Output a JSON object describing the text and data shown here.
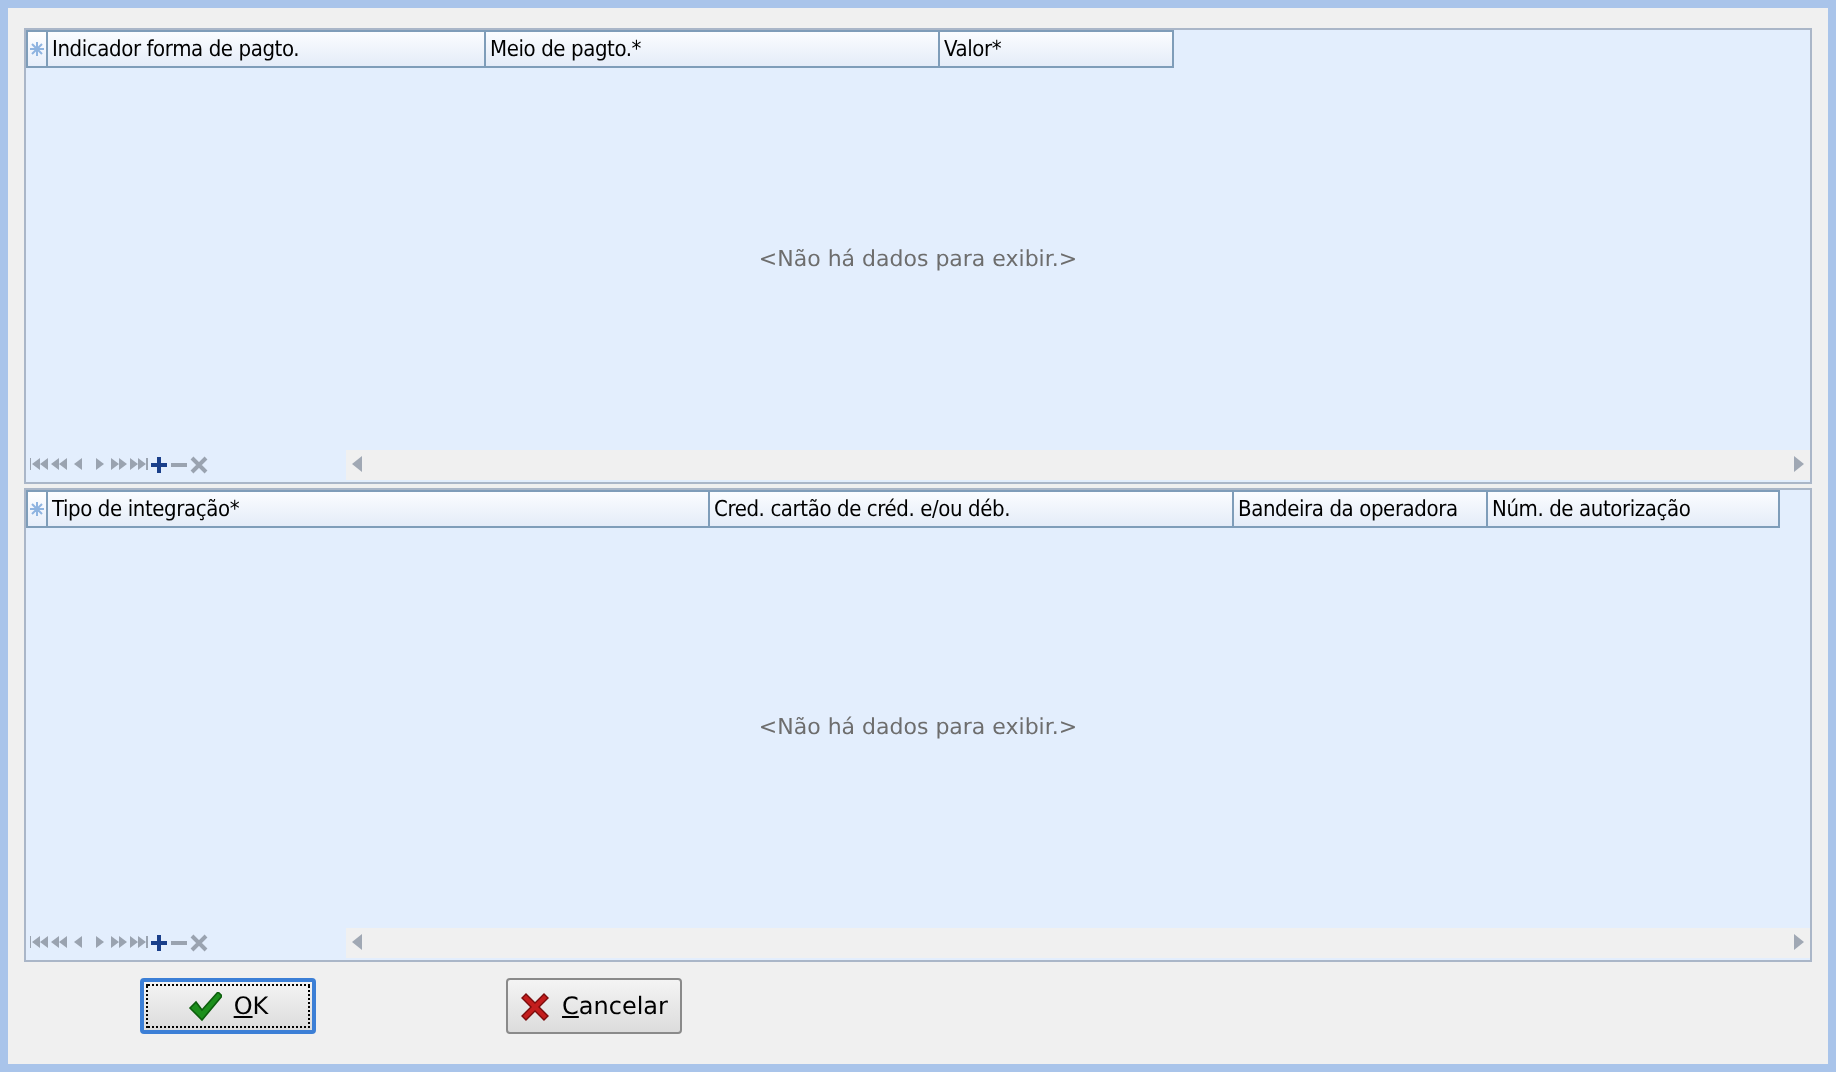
{
  "grids": [
    {
      "columns": [
        "Indicador forma de pagto.",
        "Meio de pagto.*",
        "Valor*"
      ],
      "empty_message": "<Não há dados para exibir.>"
    },
    {
      "columns": [
        "Tipo de integração*",
        "Cred. cartão de créd. e/ou déb.",
        "Bandeira da operadora",
        "Núm. de autorização"
      ],
      "empty_message": "<Não há dados para exibir.>"
    }
  ],
  "buttons": [
    {
      "label": "OK",
      "kind": "ok",
      "focused": true
    },
    {
      "label": "Cancelar",
      "kind": "cancel",
      "focused": false
    }
  ]
}
